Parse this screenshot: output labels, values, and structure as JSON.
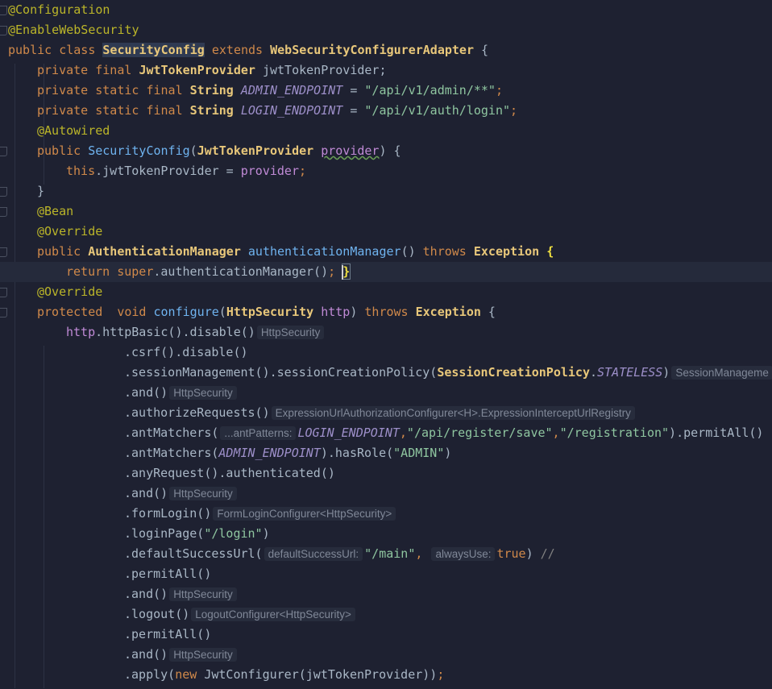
{
  "editor": {
    "colors": {
      "background": "#1e2131",
      "keyword": "#d0894a",
      "annotation": "#bbb529",
      "type": "#e8c77a",
      "string": "#8fc6a0",
      "constant": "#9d8fc9"
    },
    "current_line": 14,
    "lines": [
      {
        "indent": 0,
        "tokens": [
          [
            "@Configuration",
            "an"
          ]
        ]
      },
      {
        "indent": 0,
        "tokens": [
          [
            "@EnableWebSecurity",
            "an"
          ]
        ]
      },
      {
        "indent": 0,
        "tokens": [
          [
            "public class ",
            "kw"
          ],
          [
            "SecurityConfig",
            "ty hl"
          ],
          [
            " extends ",
            "kw"
          ],
          [
            "WebSecurityConfigurerAdapter",
            "ty"
          ],
          [
            " {",
            ""
          ]
        ]
      },
      {
        "indent": 4,
        "tokens": [
          [
            "private final ",
            "kw"
          ],
          [
            "JwtTokenProvider",
            "ty"
          ],
          [
            " jwtTokenProvider;",
            ""
          ]
        ]
      },
      {
        "indent": 4,
        "tokens": [
          [
            "private static final ",
            "kw"
          ],
          [
            "String",
            "ty"
          ],
          [
            " ",
            ""
          ],
          [
            "ADMIN_ENDPOINT",
            "co"
          ],
          [
            " = ",
            ""
          ],
          [
            "\"/api/v1/admin/**\"",
            "st"
          ],
          [
            ";",
            "kw"
          ]
        ]
      },
      {
        "indent": 4,
        "tokens": [
          [
            "private static final ",
            "kw"
          ],
          [
            "String",
            "ty"
          ],
          [
            " ",
            ""
          ],
          [
            "LOGIN_ENDPOINT",
            "co"
          ],
          [
            " = ",
            ""
          ],
          [
            "\"/api/v1/auth/login\"",
            "st"
          ],
          [
            ";",
            "kw"
          ]
        ]
      },
      {
        "indent": 4,
        "tokens": [
          [
            "@Autowired",
            "an"
          ]
        ]
      },
      {
        "indent": 4,
        "tokens": [
          [
            "public ",
            "kw"
          ],
          [
            "SecurityConfig",
            "fn"
          ],
          [
            "(",
            ""
          ],
          [
            "JwtTokenProvider",
            "ty"
          ],
          [
            " ",
            ""
          ],
          [
            "provider",
            "par wavy"
          ],
          [
            ") {",
            ""
          ]
        ]
      },
      {
        "indent": 8,
        "tokens": [
          [
            "this",
            "kw"
          ],
          [
            ".jwtTokenProvider = ",
            ""
          ],
          [
            "provider",
            "par"
          ],
          [
            ";",
            "kw"
          ]
        ]
      },
      {
        "indent": 4,
        "tokens": [
          [
            "}",
            ""
          ]
        ]
      },
      {
        "indent": 4,
        "tokens": [
          [
            "@Bean",
            "an"
          ]
        ]
      },
      {
        "indent": 4,
        "tokens": [
          [
            "@Override",
            "an"
          ]
        ]
      },
      {
        "indent": 4,
        "tokens": [
          [
            "public ",
            "kw"
          ],
          [
            "AuthenticationManager",
            "ty"
          ],
          [
            " ",
            ""
          ],
          [
            "authenticationManager",
            "fn"
          ],
          [
            "() ",
            ""
          ],
          [
            "throws ",
            "kw"
          ],
          [
            "Exception",
            "ty"
          ],
          [
            " ",
            ""
          ],
          [
            "{",
            "brace"
          ]
        ]
      },
      {
        "indent": 8,
        "tokens": [
          [
            "return super",
            "kw"
          ],
          [
            ".authenticationManager()",
            ""
          ],
          [
            "; ",
            "kw"
          ],
          [
            "}",
            "brace box"
          ]
        ]
      },
      {
        "indent": 4,
        "tokens": [
          [
            "@Override",
            "an"
          ]
        ]
      },
      {
        "indent": 4,
        "tokens": [
          [
            "protected  void ",
            "kw"
          ],
          [
            "configure",
            "fn"
          ],
          [
            "(",
            ""
          ],
          [
            "HttpSecurity",
            "ty"
          ],
          [
            " ",
            ""
          ],
          [
            "http",
            "par"
          ],
          [
            ") ",
            ""
          ],
          [
            "throws ",
            "kw"
          ],
          [
            "Exception",
            "ty"
          ],
          [
            " {",
            ""
          ]
        ]
      },
      {
        "indent": 8,
        "tokens": [
          [
            "http",
            "par"
          ],
          [
            ".httpBasic().disable()",
            ""
          ],
          [
            "HttpSecurity",
            "hint"
          ]
        ]
      },
      {
        "indent": 16,
        "tokens": [
          [
            ".csrf().disable()",
            ""
          ]
        ]
      },
      {
        "indent": 16,
        "tokens": [
          [
            ".sessionManagement().sessionCreationPolicy(",
            ""
          ],
          [
            "SessionCreationPolicy",
            "ty"
          ],
          [
            ".",
            ""
          ],
          [
            "STATELESS",
            "co"
          ],
          [
            ")",
            ""
          ],
          [
            "SessionManageme",
            "hint"
          ]
        ]
      },
      {
        "indent": 16,
        "tokens": [
          [
            ".and()",
            ""
          ],
          [
            "HttpSecurity",
            "hint"
          ]
        ]
      },
      {
        "indent": 16,
        "tokens": [
          [
            ".authorizeRequests()",
            ""
          ],
          [
            "ExpressionUrlAuthorizationConfigurer<H>.ExpressionInterceptUrlRegistry",
            "hint"
          ]
        ]
      },
      {
        "indent": 16,
        "tokens": [
          [
            ".antMatchers(",
            ""
          ],
          [
            "...antPatterns:",
            "hint"
          ],
          [
            "LOGIN_ENDPOINT",
            "co"
          ],
          [
            ",",
            "kw"
          ],
          [
            "\"/api/register/save\"",
            "st"
          ],
          [
            ",",
            "kw"
          ],
          [
            "\"/registration\"",
            "st"
          ],
          [
            ").permitAll()",
            ""
          ]
        ]
      },
      {
        "indent": 16,
        "tokens": [
          [
            ".antMatchers(",
            ""
          ],
          [
            "ADMIN_ENDPOINT",
            "co"
          ],
          [
            ").hasRole(",
            ""
          ],
          [
            "\"ADMIN\"",
            "st"
          ],
          [
            ")",
            ""
          ]
        ]
      },
      {
        "indent": 16,
        "tokens": [
          [
            ".anyRequest().authenticated()",
            ""
          ]
        ]
      },
      {
        "indent": 16,
        "tokens": [
          [
            ".and()",
            ""
          ],
          [
            "HttpSecurity",
            "hint"
          ]
        ]
      },
      {
        "indent": 16,
        "tokens": [
          [
            ".formLogin()",
            ""
          ],
          [
            "FormLoginConfigurer<HttpSecurity>",
            "hint"
          ]
        ]
      },
      {
        "indent": 16,
        "tokens": [
          [
            ".loginPage(",
            ""
          ],
          [
            "\"/login\"",
            "st"
          ],
          [
            ")",
            ""
          ]
        ]
      },
      {
        "indent": 16,
        "tokens": [
          [
            ".defaultSuccessUrl(",
            ""
          ],
          [
            "defaultSuccessUrl:",
            "hint"
          ],
          [
            "\"/main\"",
            "st"
          ],
          [
            ",",
            "kw"
          ],
          [
            " ",
            ""
          ],
          [
            "alwaysUse:",
            "hint"
          ],
          [
            "true",
            "kw"
          ],
          [
            ") ",
            ""
          ],
          [
            "//",
            "cm"
          ]
        ]
      },
      {
        "indent": 16,
        "tokens": [
          [
            ".permitAll()",
            ""
          ]
        ]
      },
      {
        "indent": 16,
        "tokens": [
          [
            ".and()",
            ""
          ],
          [
            "HttpSecurity",
            "hint"
          ]
        ]
      },
      {
        "indent": 16,
        "tokens": [
          [
            ".logout()",
            ""
          ],
          [
            "LogoutConfigurer<HttpSecurity>",
            "hint"
          ]
        ]
      },
      {
        "indent": 16,
        "tokens": [
          [
            ".permitAll()",
            ""
          ]
        ]
      },
      {
        "indent": 16,
        "tokens": [
          [
            ".and()",
            ""
          ],
          [
            "HttpSecurity",
            "hint"
          ]
        ]
      },
      {
        "indent": 16,
        "tokens": [
          [
            ".apply(",
            ""
          ],
          [
            "new ",
            "kw"
          ],
          [
            "JwtConfigurer(jwtTokenProvider))",
            ""
          ],
          [
            ";",
            "kw"
          ]
        ]
      }
    ]
  }
}
